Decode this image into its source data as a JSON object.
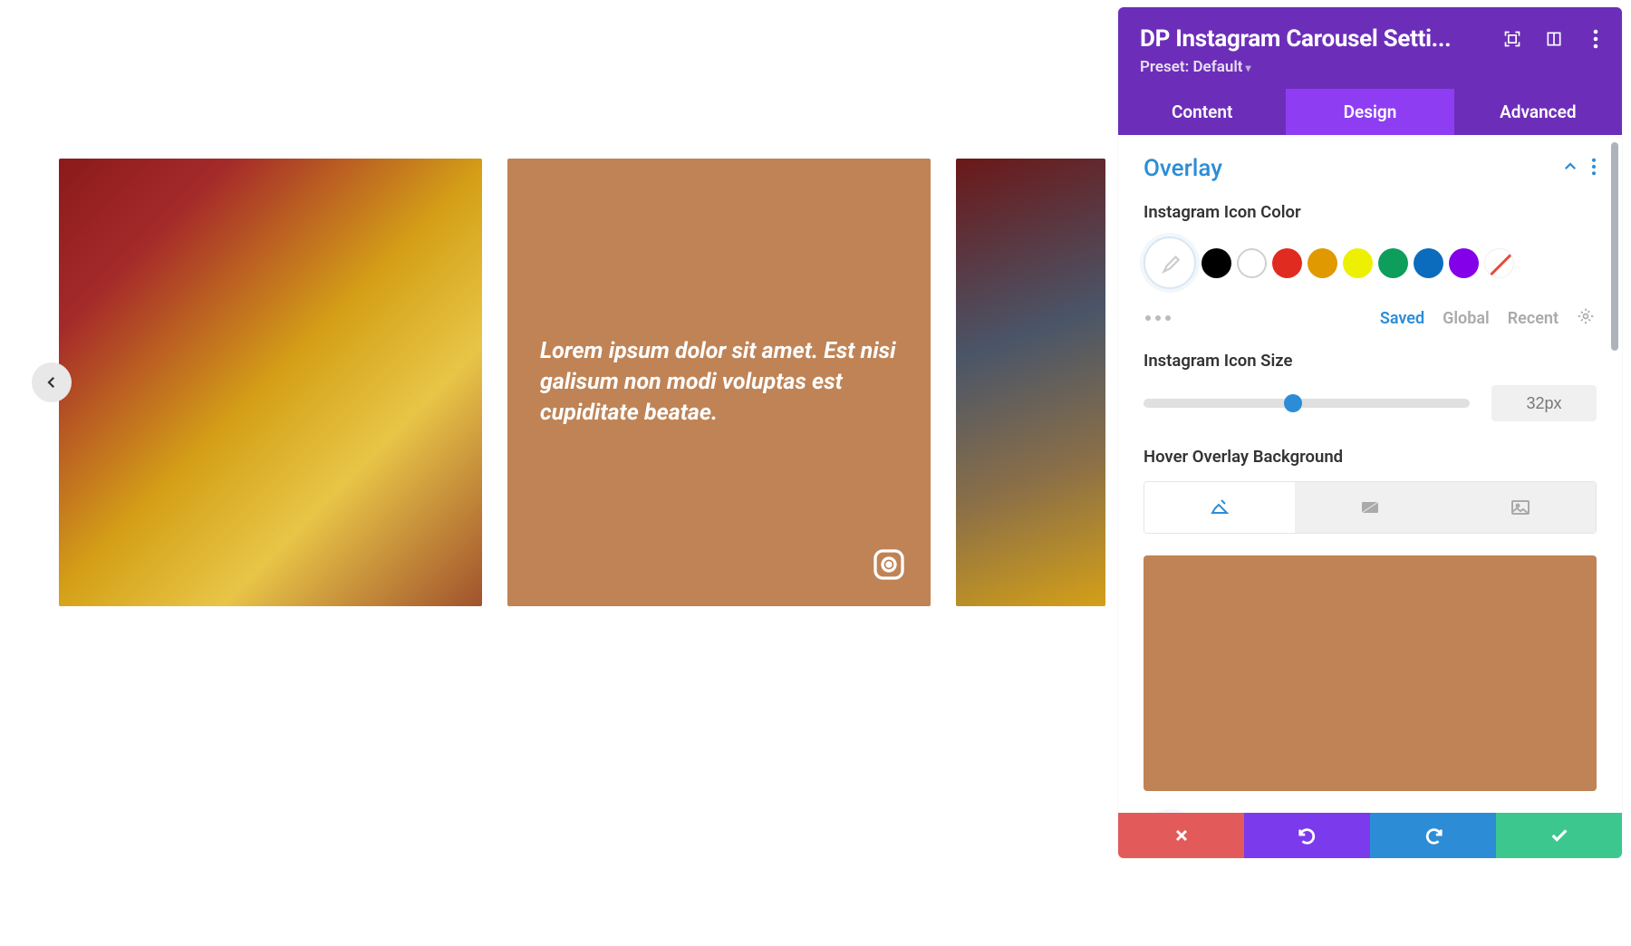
{
  "carousel": {
    "overlay_text": "Lorem ipsum dolor sit amet. Est nisi galisum non modi voluptas est cupiditate beatae."
  },
  "panel": {
    "title": "DP Instagram Carousel Setti...",
    "preset_label": "Preset: Default",
    "tabs": {
      "content": "Content",
      "design": "Design",
      "advanced": "Advanced"
    },
    "section": {
      "title": "Overlay",
      "icon_color_label": "Instagram Icon Color",
      "icon_size_label": "Instagram Icon Size",
      "icon_size_value": "32px",
      "hover_bg_label": "Hover Overlay Background",
      "hover_bg_color": "#bf8356",
      "swatch_tabs": {
        "saved": "Saved",
        "global": "Global",
        "recent": "Recent"
      },
      "palette": [
        "#000000",
        "#ffffff",
        "#e02b20",
        "#e09900",
        "#edf000",
        "#0c9e5a",
        "#0b6cbd",
        "#8300e9"
      ]
    }
  }
}
